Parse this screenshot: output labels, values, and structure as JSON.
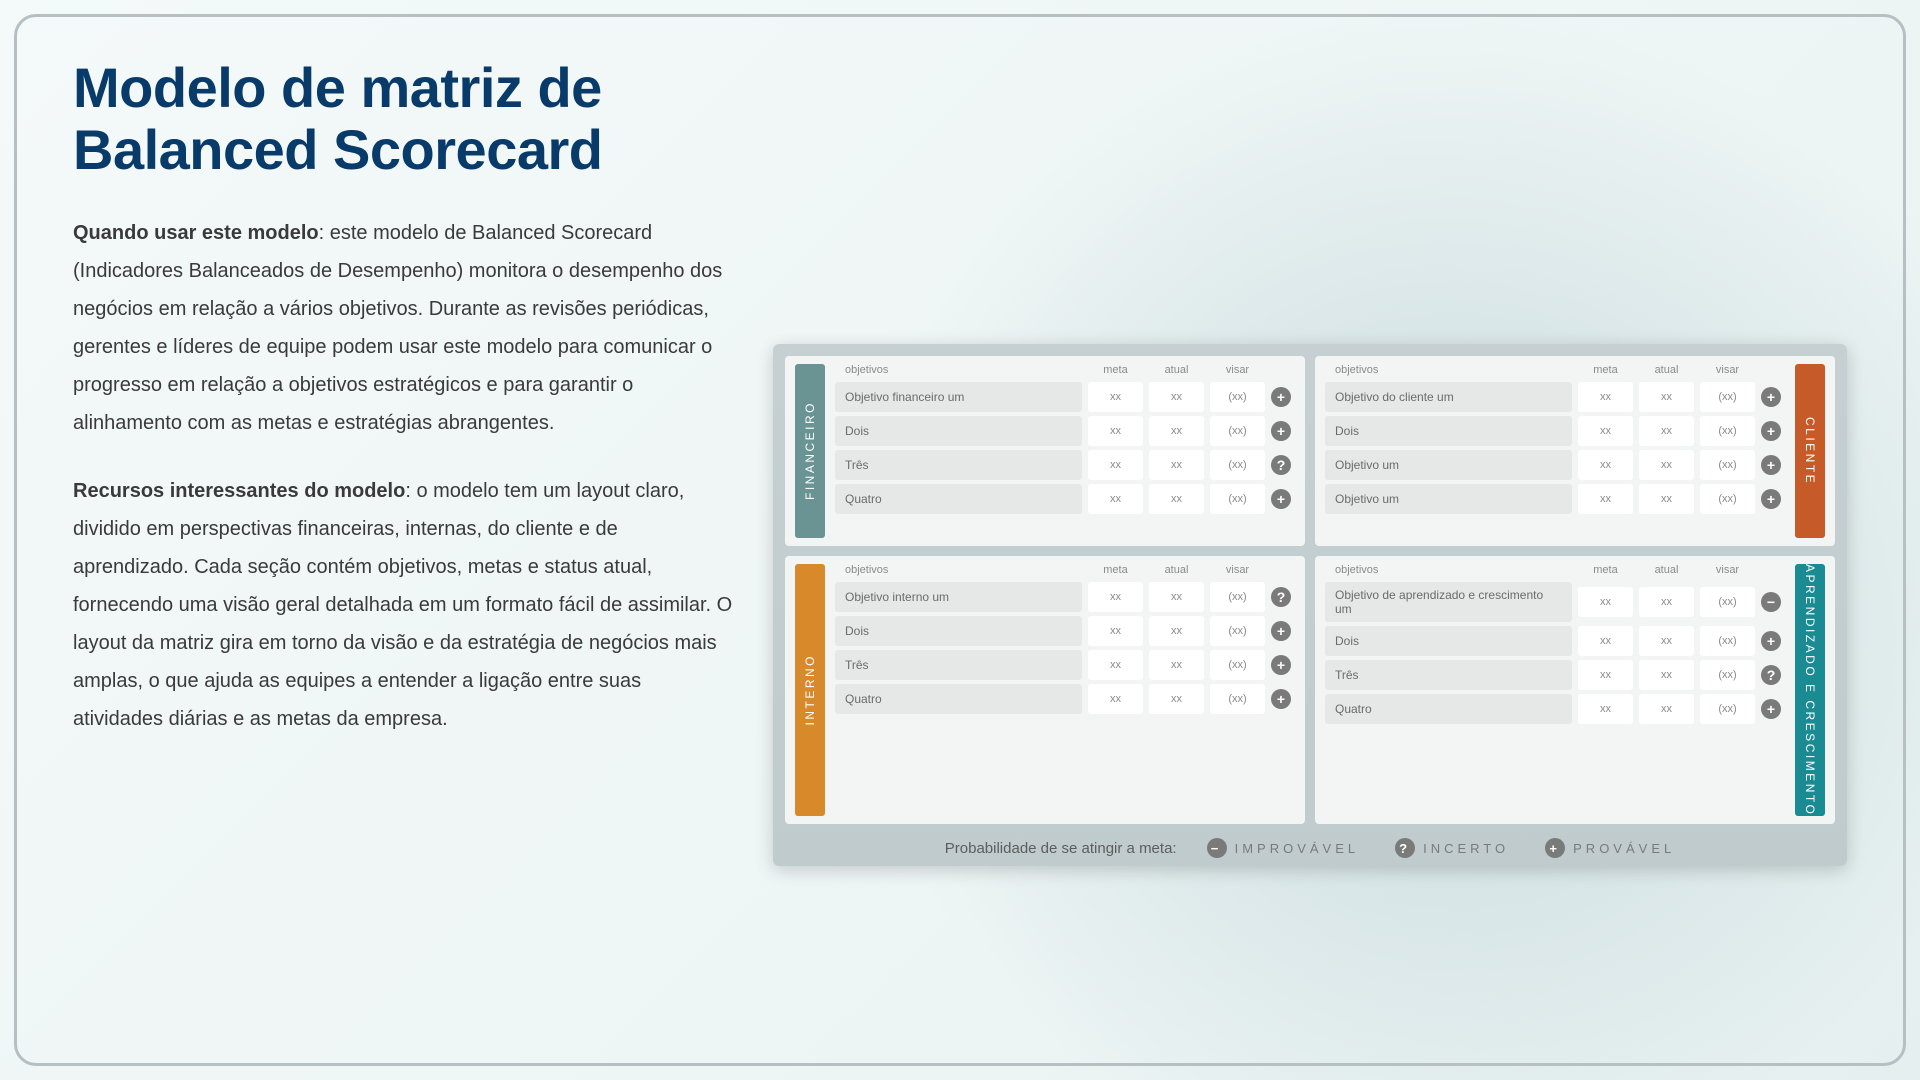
{
  "title": "Modelo de matriz de Balanced Scorecard",
  "para1_bold": "Quando usar este modelo",
  "para1_rest": ": este modelo de Balanced Scorecard (Indicadores Balanceados de Desempenho) monitora o desempenho dos negócios em relação a vários objetivos. Durante as revisões periódicas, gerentes e líderes de equipe podem usar este modelo para comunicar o progresso em relação a objetivos estratégicos e para garantir o alinhamento com as metas e estratégias abrangentes.",
  "para2_bold": "Recursos interessantes do modelo",
  "para2_rest": ": o modelo tem um layout claro, dividido em perspectivas financeiras, internas, do cliente e de aprendizado. Cada seção contém objetivos, metas e status atual, fornecendo uma visão geral detalhada em um formato fácil de assimilar. O layout da matriz gira em torno da visão e da estratégia de negócios mais amplas, o que ajuda as equipes a entender a ligação entre suas atividades diárias e as metas da empresa.",
  "headers": {
    "obj": "objetivos",
    "meta": "meta",
    "atual": "atual",
    "visar": "visar"
  },
  "status_glyphs": {
    "plus": "+",
    "minus": "−",
    "question": "?"
  },
  "quadrants": [
    {
      "id": "financeiro",
      "label": "FINANCEIRO",
      "tab_side": "left",
      "tab_class": "tab-fin",
      "rows": [
        {
          "obj": "Objetivo financeiro um",
          "meta": "xx",
          "atual": "xx",
          "visar": "(xx)",
          "status": "plus"
        },
        {
          "obj": "Dois",
          "meta": "xx",
          "atual": "xx",
          "visar": "(xx)",
          "status": "plus"
        },
        {
          "obj": "Três",
          "meta": "xx",
          "atual": "xx",
          "visar": "(xx)",
          "status": "question"
        },
        {
          "obj": "Quatro",
          "meta": "xx",
          "atual": "xx",
          "visar": "(xx)",
          "status": "plus"
        }
      ]
    },
    {
      "id": "cliente",
      "label": "CLIENTE",
      "tab_side": "right",
      "tab_class": "tab-cli",
      "rows": [
        {
          "obj": "Objetivo do cliente um",
          "meta": "xx",
          "atual": "xx",
          "visar": "(xx)",
          "status": "plus"
        },
        {
          "obj": "Dois",
          "meta": "xx",
          "atual": "xx",
          "visar": "(xx)",
          "status": "plus"
        },
        {
          "obj": "Objetivo um",
          "meta": "xx",
          "atual": "xx",
          "visar": "(xx)",
          "status": "plus"
        },
        {
          "obj": "Objetivo um",
          "meta": "xx",
          "atual": "xx",
          "visar": "(xx)",
          "status": "plus"
        }
      ]
    },
    {
      "id": "interno",
      "label": "INTERNO",
      "tab_side": "left",
      "tab_class": "tab-int",
      "rows": [
        {
          "obj": "Objetivo interno um",
          "meta": "xx",
          "atual": "xx",
          "visar": "(xx)",
          "status": "question"
        },
        {
          "obj": "Dois",
          "meta": "xx",
          "atual": "xx",
          "visar": "(xx)",
          "status": "plus"
        },
        {
          "obj": "Três",
          "meta": "xx",
          "atual": "xx",
          "visar": "(xx)",
          "status": "plus"
        },
        {
          "obj": "Quatro",
          "meta": "xx",
          "atual": "xx",
          "visar": "(xx)",
          "status": "plus"
        }
      ]
    },
    {
      "id": "aprendizado",
      "label": "APRENDIZADO E CRESCIMENTO",
      "tab_side": "right",
      "tab_class": "tab-apr",
      "rows": [
        {
          "obj": "Objetivo de aprendizado e crescimento um",
          "meta": "xx",
          "atual": "xx",
          "visar": "(xx)",
          "status": "minus"
        },
        {
          "obj": "Dois",
          "meta": "xx",
          "atual": "xx",
          "visar": "(xx)",
          "status": "plus"
        },
        {
          "obj": "Três",
          "meta": "xx",
          "atual": "xx",
          "visar": "(xx)",
          "status": "question"
        },
        {
          "obj": "Quatro",
          "meta": "xx",
          "atual": "xx",
          "visar": "(xx)",
          "status": "plus"
        }
      ]
    }
  ],
  "legend": {
    "label": "Probabilidade de se atingir a meta:",
    "items": [
      {
        "status": "minus",
        "text": "IMPROVÁVEL"
      },
      {
        "status": "question",
        "text": "INCERTO"
      },
      {
        "status": "plus",
        "text": "PROVÁVEL"
      }
    ]
  }
}
